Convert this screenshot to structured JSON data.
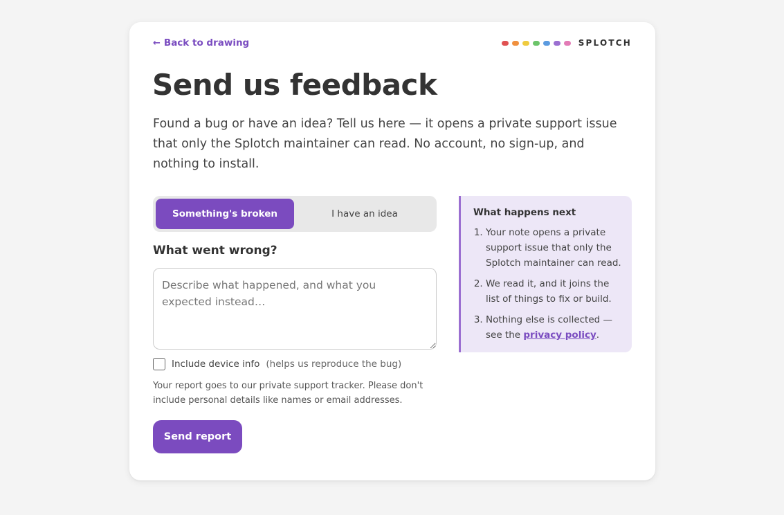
{
  "nav": {
    "back_arrow": "←",
    "back_label": "Back to drawing"
  },
  "brand": {
    "name": "SPLOTCH",
    "dot_colors": [
      "#e05252",
      "#f0913f",
      "#efcb3f",
      "#6cc46a",
      "#5b9be0",
      "#9b6fd1",
      "#e37bb6"
    ]
  },
  "page": {
    "title": "Send us feedback",
    "intro": "Found a bug or have an idea? Tell us here — it opens a private support issue that only the Splotch maintainer can read. No account, no sign-up, and nothing to install."
  },
  "form": {
    "tabs": [
      {
        "label": "Something's broken",
        "active": true
      },
      {
        "label": "I have an idea",
        "active": false
      }
    ],
    "field_label": "What went wrong?",
    "textarea_placeholder": "Describe what happened, and what you expected instead…",
    "textarea_value": "",
    "device_info_label": "Include device info",
    "device_info_hint": "(helps us reproduce the bug)",
    "device_info_checked": false,
    "privacy_note": "Your report goes to our private support tracker. Please don't include personal details like names or email addresses.",
    "submit_label": "Send report"
  },
  "sidebar": {
    "title": "What happens next",
    "steps": [
      "Your note opens a private support issue that only the Splotch maintainer can read.",
      "We read it, and it joins the list of things to fix or build."
    ],
    "step3_prefix": "Nothing else is collected — see the ",
    "step3_link": "privacy policy",
    "step3_suffix": "."
  },
  "colors": {
    "accent": "#7b4bbf",
    "panel_bg": "#ede7f7",
    "page_bg": "#f4f4f4"
  }
}
